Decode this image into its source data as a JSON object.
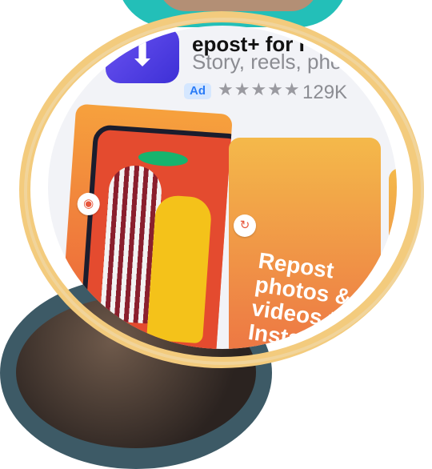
{
  "app": {
    "icon": "repost-icon",
    "icon_glyph": "⬇",
    "title": "epost+ for I",
    "subtitle": "Story, reels, photo",
    "badge": "Ad",
    "rating_stars": "★★★★★",
    "rating_count": "129K",
    "brand_color": "#5442e8"
  },
  "cards": {
    "camera_glyph": "◉",
    "repost_glyph": "↻",
    "promo_text": "Repost\nphotos &\nvideos to\nInsta"
  }
}
